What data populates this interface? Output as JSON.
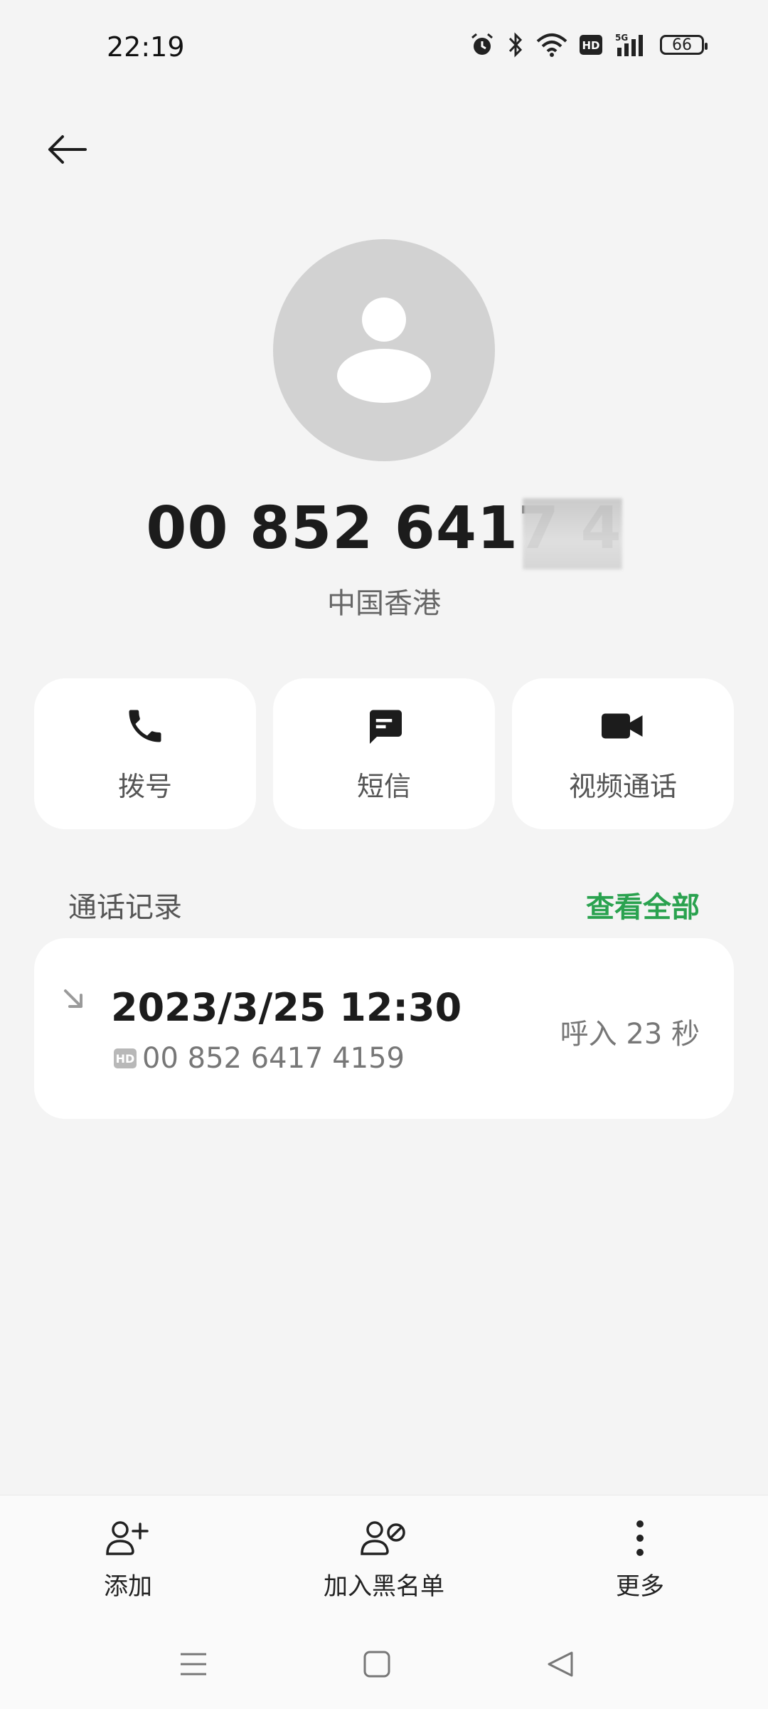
{
  "status_bar": {
    "time": "22:19",
    "battery": "66",
    "icons": [
      "alarm-icon",
      "bluetooth-icon",
      "wifi-icon",
      "hd-icon",
      "5g-signal-icon",
      "battery-icon"
    ]
  },
  "contact": {
    "number": "00 852 6417 4",
    "region": "中国香港"
  },
  "actions": [
    {
      "label": "拨号",
      "icon": "phone-icon"
    },
    {
      "label": "短信",
      "icon": "message-icon"
    },
    {
      "label": "视频通话",
      "icon": "video-icon"
    }
  ],
  "call_log": {
    "title": "通话记录",
    "view_all": "查看全部",
    "entry": {
      "date": "2023/3/25 12:30",
      "badge": "HD",
      "number": "00 852 6417 4159",
      "meta": "呼入  23 秒"
    }
  },
  "bottom": {
    "add": "添加",
    "blacklist": "加入黑名单",
    "more": "更多"
  },
  "colors": {
    "accent": "#2aa24f",
    "background": "#f4f4f4",
    "avatar": "#d2d2d2"
  }
}
